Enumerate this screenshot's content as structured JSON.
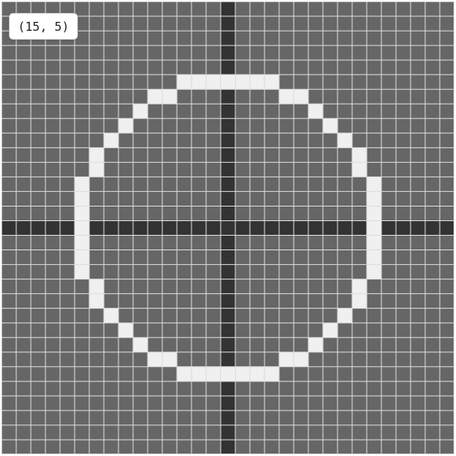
{
  "grid": {
    "columns": 31,
    "rows": 31,
    "origin_col": 15,
    "origin_row": 15,
    "background_color": "#666666",
    "grid_line_color": "#dcdcdc",
    "axis_color": "#333333",
    "filled_color": "#f0f0f0"
  },
  "coordinate_readout": "(15, 5)",
  "filled_cells": [
    [
      12,
      5
    ],
    [
      13,
      5
    ],
    [
      14,
      5
    ],
    [
      15,
      5
    ],
    [
      16,
      5
    ],
    [
      17,
      5
    ],
    [
      18,
      5
    ],
    [
      10,
      6
    ],
    [
      11,
      6
    ],
    [
      19,
      6
    ],
    [
      20,
      6
    ],
    [
      9,
      7
    ],
    [
      21,
      7
    ],
    [
      8,
      8
    ],
    [
      22,
      8
    ],
    [
      7,
      9
    ],
    [
      23,
      9
    ],
    [
      6,
      10
    ],
    [
      24,
      10
    ],
    [
      6,
      11
    ],
    [
      24,
      11
    ],
    [
      5,
      12
    ],
    [
      25,
      12
    ],
    [
      5,
      13
    ],
    [
      25,
      13
    ],
    [
      5,
      14
    ],
    [
      25,
      14
    ],
    [
      5,
      15
    ],
    [
      25,
      15
    ],
    [
      5,
      16
    ],
    [
      25,
      16
    ],
    [
      5,
      17
    ],
    [
      25,
      17
    ],
    [
      5,
      18
    ],
    [
      25,
      18
    ],
    [
      6,
      19
    ],
    [
      24,
      19
    ],
    [
      6,
      20
    ],
    [
      24,
      20
    ],
    [
      7,
      21
    ],
    [
      23,
      21
    ],
    [
      8,
      22
    ],
    [
      22,
      22
    ],
    [
      9,
      23
    ],
    [
      21,
      23
    ],
    [
      10,
      24
    ],
    [
      11,
      24
    ],
    [
      19,
      24
    ],
    [
      20,
      24
    ],
    [
      12,
      25
    ],
    [
      13,
      25
    ],
    [
      14,
      25
    ],
    [
      15,
      25
    ],
    [
      16,
      25
    ],
    [
      17,
      25
    ],
    [
      18,
      25
    ]
  ]
}
